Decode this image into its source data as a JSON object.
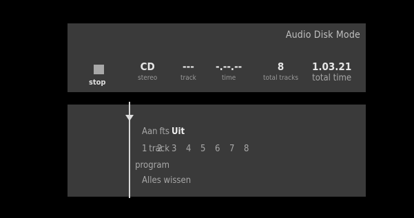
{
  "mode_title": "Audio Disk Mode",
  "transport": {
    "label": "stop"
  },
  "source": {
    "value": "CD",
    "label": "stereo"
  },
  "track": {
    "value": "---",
    "label": "track"
  },
  "time": {
    "value": "-.--.--",
    "label": "time"
  },
  "total_tracks": {
    "value": "8",
    "label": "total tracks"
  },
  "total_time": {
    "value": "1.03.21",
    "label": "total time"
  },
  "rows": {
    "fts": "fts",
    "track": "track",
    "program": "program"
  },
  "fts_options": {
    "on": "Aan",
    "off": "Uit",
    "selected": "Uit"
  },
  "track_numbers": [
    "1",
    "2",
    "3",
    "4",
    "5",
    "6",
    "7",
    "8"
  ],
  "clear_all": "Alles wissen"
}
